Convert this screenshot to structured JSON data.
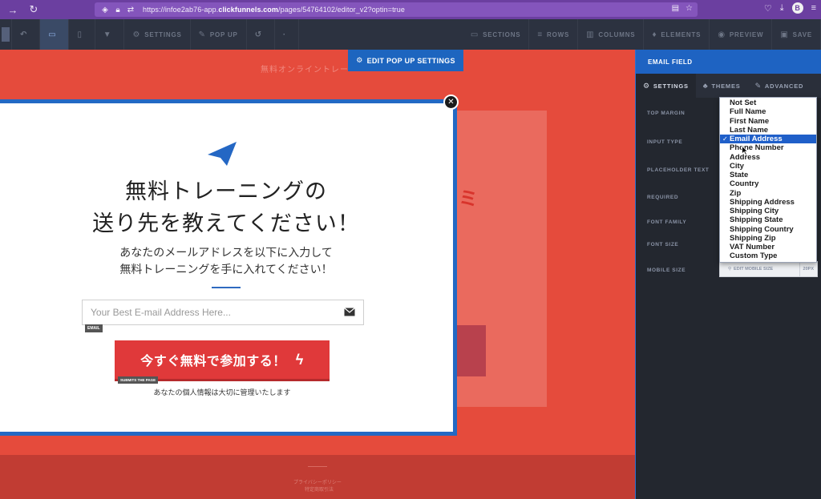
{
  "browser": {
    "url_prefix": "https://infoe2ab76-app.",
    "url_domain": "clickfunnels.com",
    "url_path": "/pages/54764102/editor_v2?optin=true",
    "profile_initial": "B"
  },
  "toolbar": {
    "settings": "SETTINGS",
    "popup": "POP UP",
    "sections": "SECTIONS",
    "rows": "ROWS",
    "columns": "COLUMNS",
    "elements": "ELEMENTS",
    "preview": "PREVIEW",
    "save": "SAVE"
  },
  "canvas": {
    "headline": "無料オンライントレー",
    "stray_char": "ミ",
    "footer_text1": "プライバシーポリシー",
    "footer_text2": "特定商取引法",
    "edit_popup_label": "EDIT POP UP SETTINGS"
  },
  "popup": {
    "title_line1": "無料トレーニングの",
    "title_line2": "送り先を教えてください！",
    "sub_line1": "あなたのメールアドレスを以下に入力して",
    "sub_line2": "無料トレーニングを手に入れてください！",
    "email_placeholder": "Your Best E-mail Address Here...",
    "email_tag": "EMAIL",
    "submit_label": "今すぐ無料で参加する！",
    "submit_tag": "SUBMITS THE PAGE",
    "privacy": "あなたの個人情報は大切に管理いたします"
  },
  "panel": {
    "header": "EMAIL FIELD",
    "tabs": [
      "SETTINGS",
      "THEMES",
      "ADVANCED"
    ],
    "labels": {
      "top_margin": "TOP MARGIN",
      "input_type": "INPUT TYPE",
      "placeholder_text": "PLACEHOLDER TEXT",
      "required": "REQUIRED",
      "font_family": "FONT FAMILY",
      "font_size": "FONT SIZE",
      "mobile_size": "MOBILE SIZE"
    },
    "mobile_size_btn": "EDIT MOBILE SIZE",
    "mobile_size_value": "20PX"
  },
  "dropdown": {
    "selected": "Email Address",
    "options": [
      "Not Set",
      "Full Name",
      "First Name",
      "Last Name",
      "Email Address",
      "Phone Number",
      "Address",
      "City",
      "State",
      "Country",
      "Zip",
      "Shipping Address",
      "Shipping City",
      "Shipping State",
      "Shipping Country",
      "Shipping Zip",
      "VAT Number",
      "Custom Type"
    ]
  },
  "colors": {
    "canvas_red": "#e54b3c",
    "popup_border": "#2369c4",
    "submit_red": "#e0393a",
    "panel_blue": "#1e63c2",
    "browser_purple": "#6b3fa0"
  }
}
